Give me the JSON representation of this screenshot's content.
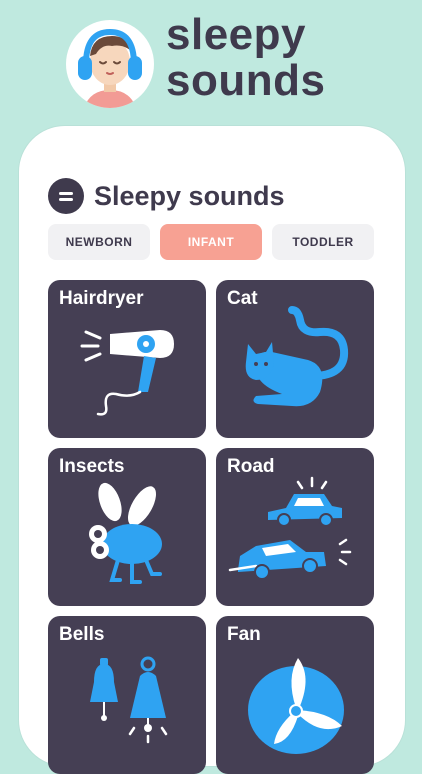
{
  "brand": {
    "line1": "sleepy",
    "line2": "sounds"
  },
  "app": {
    "title": "Sleepy sounds"
  },
  "tabs": [
    {
      "label": "NEWBORN",
      "active": false
    },
    {
      "label": "INFANT",
      "active": true
    },
    {
      "label": "TODDLER",
      "active": false
    }
  ],
  "sounds": [
    {
      "label": "Hairdryer",
      "icon": "hairdryer-icon"
    },
    {
      "label": "Cat",
      "icon": "cat-icon"
    },
    {
      "label": "Insects",
      "icon": "insect-icon"
    },
    {
      "label": "Road",
      "icon": "cars-icon"
    },
    {
      "label": "Bells",
      "icon": "bells-icon"
    },
    {
      "label": "Fan",
      "icon": "fan-icon"
    }
  ],
  "colors": {
    "background": "#bfe9df",
    "card": "#453f54",
    "accent": "#2fa3f2",
    "tab_active": "#f7a193",
    "text_dark": "#3f3a4d"
  }
}
